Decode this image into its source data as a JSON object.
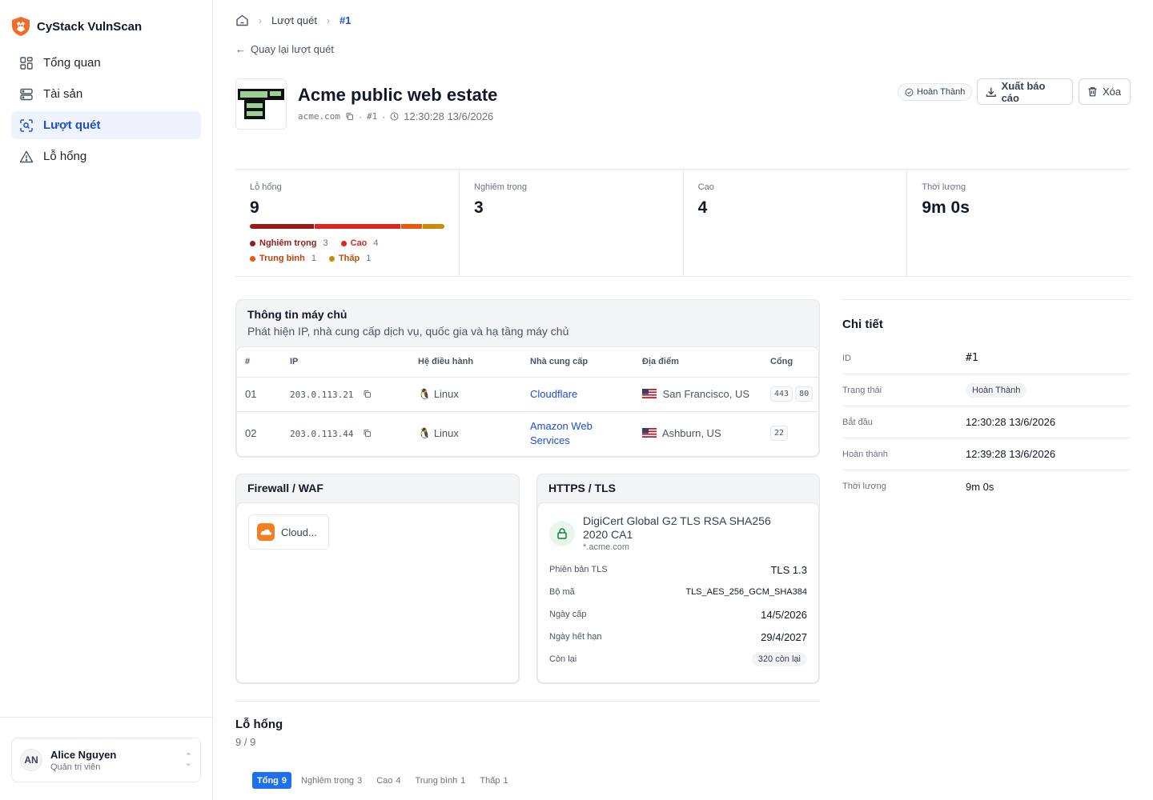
{
  "app": {
    "name": "CyStack VulnScan"
  },
  "nav": [
    {
      "label": "Tổng quan",
      "icon": "grid-icon"
    },
    {
      "label": "Tài sản",
      "icon": "server-icon"
    },
    {
      "label": "Lượt quét",
      "icon": "scan-icon",
      "active": true
    },
    {
      "label": "Lỗ hổng",
      "icon": "warning-icon"
    }
  ],
  "user": {
    "initials": "AN",
    "name": "Alice Nguyen",
    "role": "Quản trị viên"
  },
  "breadcrumb": {
    "section": "Lượt quét",
    "current": "#1"
  },
  "back_link": "Quay lại lượt quét",
  "header": {
    "title": "Acme public web estate",
    "domain": "acme.com",
    "scan_id": "#1",
    "timestamp": "12:30:28 13/6/2026",
    "status": "Hoàn Thành",
    "export_label": "Xuất báo cáo",
    "delete_label": "Xóa"
  },
  "stats": {
    "vulns": {
      "label": "Lỗ hổng",
      "value": "9"
    },
    "critical": {
      "label": "Nghiêm trọng",
      "value": "3"
    },
    "high": {
      "label": "Cao",
      "value": "4"
    },
    "duration": {
      "label": "Thời lượng",
      "value": "9m 0s"
    },
    "severity_breakdown": [
      {
        "name": "Nghiêm trọng",
        "count": 3,
        "color": "#991b1b"
      },
      {
        "name": "Cao",
        "count": 4,
        "color": "#dc2626"
      },
      {
        "name": "Trung bình",
        "count": 1,
        "color": "#ea580c"
      },
      {
        "name": "Thấp",
        "count": 1,
        "color": "#ca8a04"
      }
    ]
  },
  "hosts": {
    "title": "Thông tin máy chủ",
    "subtitle": "Phát hiện IP, nhà cung cấp dịch vụ, quốc gia và hạ tầng máy chủ",
    "columns": [
      "#",
      "IP",
      "Hệ điều hành",
      "Nhà cung cấp",
      "Địa điểm",
      "Cổng"
    ],
    "rows": [
      {
        "idx": "01",
        "ip": "203.0.113.21",
        "os": "Linux",
        "provider": "Cloudflare",
        "location": "San Francisco, US",
        "ports": [
          "443",
          "80"
        ]
      },
      {
        "idx": "02",
        "ip": "203.0.113.44",
        "os": "Linux",
        "provider": "Amazon Web Services",
        "location": "Ashburn, US",
        "ports": [
          "22"
        ]
      }
    ]
  },
  "waf": {
    "title": "Firewall / WAF",
    "item": "Cloud..."
  },
  "tls": {
    "title": "HTTPS / TLS",
    "issuer": "DigiCert Global G2 TLS RSA SHA256 2020 CA1",
    "subject": "*.acme.com",
    "rows": {
      "version": {
        "key": "Phiên bản TLS",
        "value": "TLS 1.3"
      },
      "cipher": {
        "key": "Bộ mã",
        "value": "TLS_AES_256_GCM_SHA384"
      },
      "issued": {
        "key": "Ngày cấp",
        "value": "14/5/2026"
      },
      "expires": {
        "key": "Ngày hết hạn",
        "value": "29/4/2027"
      },
      "remaining": {
        "key": "Còn lại",
        "value": "320 còn lại"
      }
    }
  },
  "details": {
    "title": "Chi tiết",
    "id": {
      "key": "ID",
      "value": "#1"
    },
    "status": {
      "key": "Trạng thái",
      "value": "Hoàn Thành"
    },
    "start": {
      "key": "Bắt đầu",
      "value": "12:30:28 13/6/2026"
    },
    "finish": {
      "key": "Hoàn thành",
      "value": "12:39:28 13/6/2026"
    },
    "duration": {
      "key": "Thời lượng",
      "value": "9m 0s"
    }
  },
  "vulns": {
    "title": "Lỗ hổng",
    "count": "9 / 9",
    "tabs": [
      {
        "label": "Tổng",
        "count": "9",
        "active": true
      },
      {
        "label": "Nghiêm trọng",
        "count": "3"
      },
      {
        "label": "Cao",
        "count": "4"
      },
      {
        "label": "Trung bình",
        "count": "1"
      },
      {
        "label": "Thấp",
        "count": "1"
      }
    ]
  }
}
